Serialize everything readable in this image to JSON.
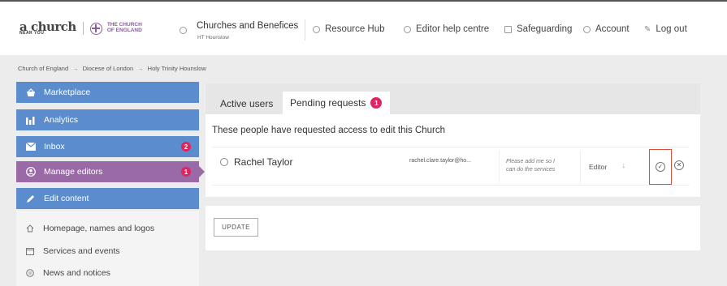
{
  "header": {
    "logo": {
      "line1": "a church",
      "line2": "NEAR YOU",
      "coe_line1": "THE CHURCH",
      "coe_line2": "OF ENGLAND"
    },
    "context_title": "Churches and Benefices",
    "context_sub": "HT Hounslow",
    "nav": [
      {
        "label": "Resource Hub",
        "icon": "hub-icon"
      },
      {
        "label": "Editor help centre",
        "icon": "help-icon"
      },
      {
        "label": "Safeguarding",
        "icon": "safeguarding-icon"
      },
      {
        "label": "Account",
        "icon": "account-icon"
      },
      {
        "label": "Log out",
        "icon": "logout-icon"
      }
    ]
  },
  "breadcrumb": [
    "Church of England",
    "Diocese of London",
    "Holy Trinity Hounslow"
  ],
  "breadcrumb_separator": "→",
  "sidebar": {
    "items": [
      {
        "label": "Marketplace",
        "icon": "basket-icon"
      },
      {
        "label": "Analytics",
        "icon": "bar-chart-icon"
      },
      {
        "label": "Inbox",
        "icon": "mail-icon",
        "count": "2"
      },
      {
        "label": "Manage editors",
        "icon": "user-icon",
        "count": "1",
        "active": true
      },
      {
        "label": "Edit content",
        "icon": "pencil-icon"
      }
    ],
    "sub_items": [
      {
        "label": "Homepage, names and logos",
        "icon": "home-icon"
      },
      {
        "label": "Services and events",
        "icon": "calendar-icon"
      },
      {
        "label": "News and notices",
        "icon": "news-icon"
      }
    ]
  },
  "tabs": [
    {
      "label": "Active users"
    },
    {
      "label": "Pending requests",
      "badge": "1",
      "active": true
    }
  ],
  "panel": {
    "heading": "These people have requested access to edit this Church",
    "request": {
      "name": "Rachel Taylor",
      "email": "rachel.clare.taylor@ho...",
      "note_line1": "Please add me so I",
      "note_line2": "can do the services",
      "role": "Editor"
    },
    "update_label": "UPDATE"
  },
  "colors": {
    "sidebar_blue": "#5b8ccd",
    "sidebar_active": "#9a6aa6",
    "badge": "#e0245e",
    "highlight": "#e14b3c"
  }
}
